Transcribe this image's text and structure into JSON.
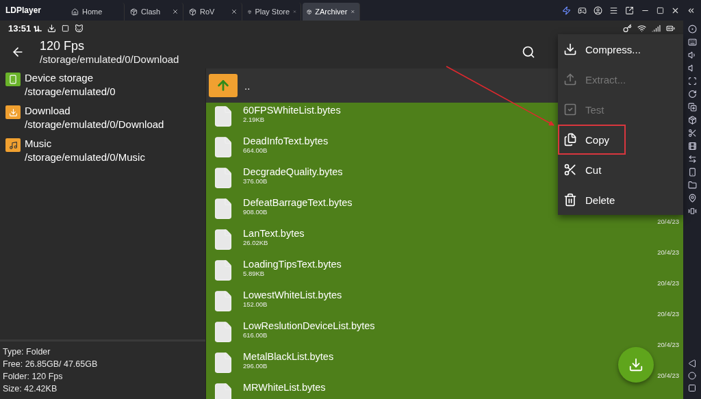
{
  "emulator": {
    "brand": "LDPlayer",
    "tabs": [
      {
        "label": "Home",
        "kind": "home",
        "selected": false
      },
      {
        "label": "Clash",
        "kind": "app",
        "selected": false
      },
      {
        "label": "RoV",
        "kind": "app",
        "selected": false
      },
      {
        "label": "Play Store",
        "kind": "app",
        "selected": false
      },
      {
        "label": "ZArchiver",
        "kind": "app",
        "selected": true
      }
    ]
  },
  "status_bar": {
    "time": "13:51 น."
  },
  "header": {
    "title": "120 Fps",
    "path": "/storage/emulated/0/Download"
  },
  "sidebar": {
    "items": [
      {
        "name": "Device storage",
        "path": "/storage/emulated/0",
        "kind": "device"
      },
      {
        "name": "Download",
        "path": "/storage/emulated/0/Download",
        "kind": "download"
      },
      {
        "name": "Music",
        "path": "/storage/emulated/0/Music",
        "kind": "music"
      }
    ],
    "info": [
      "Type: Folder",
      "Free: 26.85GB/ 47.65GB",
      "Folder: 120 Fps",
      "Size: 42.42KB"
    ]
  },
  "files": {
    "parent": "..",
    "rows": [
      {
        "name": "60FPSWhiteList.bytes",
        "size": "2.19KB",
        "selected": true
      },
      {
        "name": "DeadInfoText.bytes",
        "size": "664.00B",
        "selected": true
      },
      {
        "name": "DecgradeQuality.bytes",
        "size": "376.00B",
        "selected": true
      },
      {
        "name": "DefeatBarrageText.bytes",
        "size": "908.00B",
        "date": "20/4/23",
        "selected": true
      },
      {
        "name": "LanText.bytes",
        "size": "26.02KB",
        "date": "20/4/23",
        "selected": true
      },
      {
        "name": "LoadingTipsText.bytes",
        "size": "5.89KB",
        "date": "20/4/23",
        "selected": true
      },
      {
        "name": "LowestWhiteList.bytes",
        "size": "152.00B",
        "date": "20/4/23",
        "selected": true
      },
      {
        "name": "LowReslutionDeviceList.bytes",
        "size": "616.00B",
        "date": "20/4/23",
        "selected": true
      },
      {
        "name": "MetalBlackList.bytes",
        "size": "296.00B",
        "date": "20/4/23",
        "selected": true
      },
      {
        "name": "MRWhiteList.bytes",
        "selected": true
      }
    ]
  },
  "menu": {
    "items": [
      {
        "label": "Compress...",
        "kind": "compress",
        "disabled": false,
        "highlighted": false
      },
      {
        "label": "Extract...",
        "kind": "extract",
        "disabled": true,
        "highlighted": false
      },
      {
        "label": "Test",
        "kind": "test",
        "disabled": true,
        "highlighted": false
      },
      {
        "label": "Copy",
        "kind": "copy",
        "disabled": false,
        "highlighted": true
      },
      {
        "label": "Cut",
        "kind": "cut",
        "disabled": false,
        "highlighted": false
      },
      {
        "label": "Delete",
        "kind": "delete",
        "disabled": false,
        "highlighted": false
      }
    ]
  }
}
